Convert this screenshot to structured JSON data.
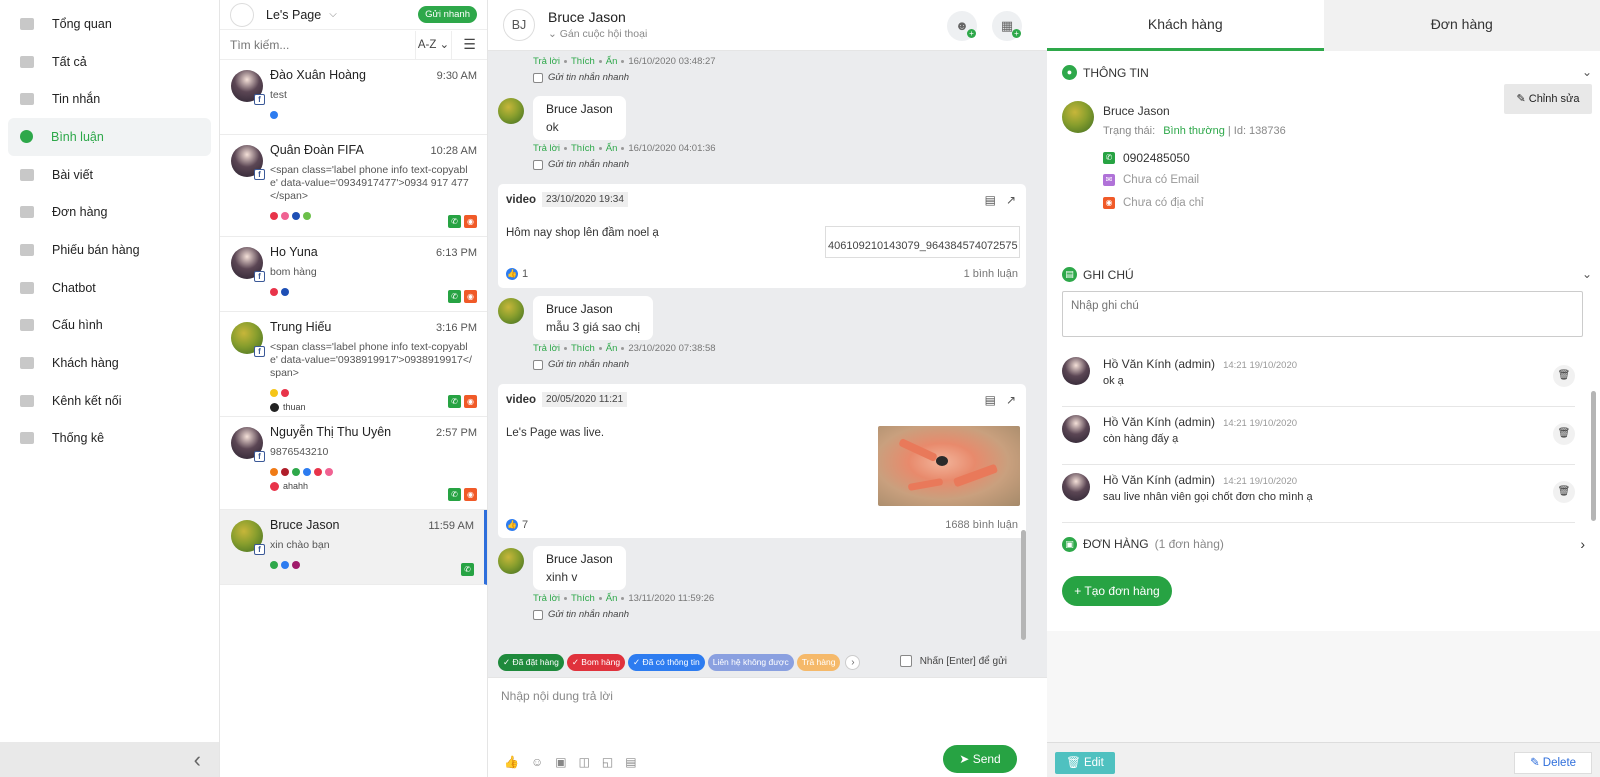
{
  "sidebar": {
    "items": [
      {
        "label": "Tổng quan",
        "icon": "dashboard-icon"
      },
      {
        "label": "Tất cả",
        "icon": "inbox-icon"
      },
      {
        "label": "Tin nhắn",
        "icon": "message-icon"
      },
      {
        "label": "Bình luận",
        "icon": "comment-icon",
        "active": true
      },
      {
        "label": "Bài viết",
        "icon": "post-icon"
      },
      {
        "label": "Đơn hàng",
        "icon": "cart-icon"
      },
      {
        "label": "Phiếu bán hàng",
        "icon": "receipt-icon"
      },
      {
        "label": "Chatbot",
        "icon": "bot-icon"
      },
      {
        "label": "Cấu hình",
        "icon": "gear-icon"
      },
      {
        "label": "Khách hàng",
        "icon": "gear-icon"
      },
      {
        "label": "Kênh kết nối",
        "icon": "facebook-icon"
      },
      {
        "label": "Thống kê",
        "icon": "pie-chart-icon"
      }
    ],
    "collapse_glyph": "‹"
  },
  "convlist": {
    "page_name": "Le's Page",
    "quick_send": "Gửi nhanh",
    "search_placeholder": "Tìm kiếm...",
    "sort_label": "A-Z",
    "items": [
      {
        "name": "Đào Xuân Hoàng",
        "time": "9:30 AM",
        "preview": "test",
        "dots": [
          "#2d7cf0"
        ],
        "icons": []
      },
      {
        "name": "Quân Đoàn FIFA",
        "time": "10:28 AM",
        "preview": "<span class='label phone info text-copyable' data-value='0934917477'>0934 917 477</span>",
        "dots": [
          "#e8344a",
          "#f06292",
          "#1e4fb5",
          "#6cc04a"
        ],
        "icons": [
          "phone",
          "location"
        ]
      },
      {
        "name": "Ho Yuna",
        "time": "6:13 PM",
        "preview": "bom hàng",
        "dots": [
          "#e8344a",
          "#1e4fb5"
        ],
        "icons": [
          "phone",
          "location"
        ]
      },
      {
        "name": "Trung Hiếu",
        "time": "3:16 PM",
        "preview": "<span class='label phone info text-copyable' data-value='0938919917'>0938919917</span>",
        "dots": [
          "#f5c518",
          "#e8344a"
        ],
        "assignee": "thuan",
        "icons": [
          "phone",
          "location"
        ]
      },
      {
        "name": "Nguyễn Thị Thu Uyên",
        "time": "2:57 PM",
        "preview": "9876543210",
        "dots": [
          "#f07b16",
          "#b01e2a",
          "#2ea84a",
          "#2d7cf0",
          "#e8344a",
          "#f06292"
        ],
        "assignee": "ahahh",
        "icons": [
          "phone",
          "location"
        ]
      },
      {
        "name": "Bruce Jason",
        "time": "11:59 AM",
        "preview": "xin chào bạn",
        "dots": [
          "#2ea84a",
          "#2d7cf0",
          "#a01a6a"
        ],
        "icons": [
          "phone"
        ],
        "active": true
      }
    ]
  },
  "chat": {
    "initials": "BJ",
    "name": "Bruce Jason",
    "subtitle": "Gán cuộc hội thoại",
    "reply_label": "Trả lời",
    "like_label": "Thích",
    "hide_label": "Ẩn",
    "quick_label": "Gửi tin nhắn nhanh",
    "comments": [
      {
        "name": "",
        "text": "",
        "time": "16/10/2020 03:48:27"
      },
      {
        "name": "Bruce Jason",
        "text": "ok",
        "time": "16/10/2020 04:01:36"
      },
      {
        "name": "Bruce Jason",
        "text": "mẫu 3 giá sao chị",
        "time": "23/10/2020 07:38:58"
      },
      {
        "name": "Bruce Jason",
        "text": "xinh v",
        "time": "13/11/2020 11:59:26"
      }
    ],
    "posts": [
      {
        "type": "video",
        "date": "23/10/2020 19:34",
        "text": "Hôm nay shop lên đầm noel ạ",
        "image_alt": "406109210143079_964384574072575",
        "likes": "1",
        "comments": "1 bình luận"
      },
      {
        "type": "video",
        "date": "20/05/2020 11:21",
        "text": "Le's Page was live.",
        "likes": "7",
        "comments": "1688 bình luận"
      }
    ],
    "tags": [
      {
        "label": "Đã đặt hàng",
        "color": "#1f8a3c"
      },
      {
        "label": "Bom hàng",
        "color": "#e0323c"
      },
      {
        "label": "Đã có thông tin",
        "color": "#2d7cf0"
      },
      {
        "label": "Liên hệ không được",
        "color": "#8aa0e0"
      },
      {
        "label": "Trả hàng",
        "color": "#f5b96a"
      }
    ],
    "enter_label": "Nhấn [Enter] để gửi",
    "reply_placeholder": "Nhập nội dung trả lời",
    "send_label": "Send"
  },
  "customer": {
    "tabs": [
      "Khách hàng",
      "Đơn hàng"
    ],
    "info_title": "THÔNG TIN",
    "edit_label": "Chỉnh sửa",
    "name": "Bruce Jason",
    "status_label": "Trạng thái:",
    "status": "Bình thường",
    "id_text": "| Id: 138736",
    "phone": "0902485050",
    "email": "Chưa có Email",
    "address": "Chưa có địa chỉ",
    "notes_title": "GHI CHÚ",
    "note_placeholder": "Nhập ghi chú",
    "notes": [
      {
        "author": "Hồ Văn Kính (admin)",
        "time": "14:21 19/10/2020",
        "text": "ok ạ"
      },
      {
        "author": "Hồ Văn Kính (admin)",
        "time": "14:21 19/10/2020",
        "text": "còn hàng đấy ạ"
      },
      {
        "author": "Hồ Văn Kính (admin)",
        "time": "14:21 19/10/2020",
        "text": "sau live nhân viên gọi chốt đơn cho mình ạ"
      }
    ],
    "orders_title": "ĐƠN HÀNG",
    "orders_count": "(1 đơn hàng)",
    "create_order": "+ Tạo đơn hàng",
    "footer_edit": "Edit",
    "footer_delete": "Delete"
  }
}
